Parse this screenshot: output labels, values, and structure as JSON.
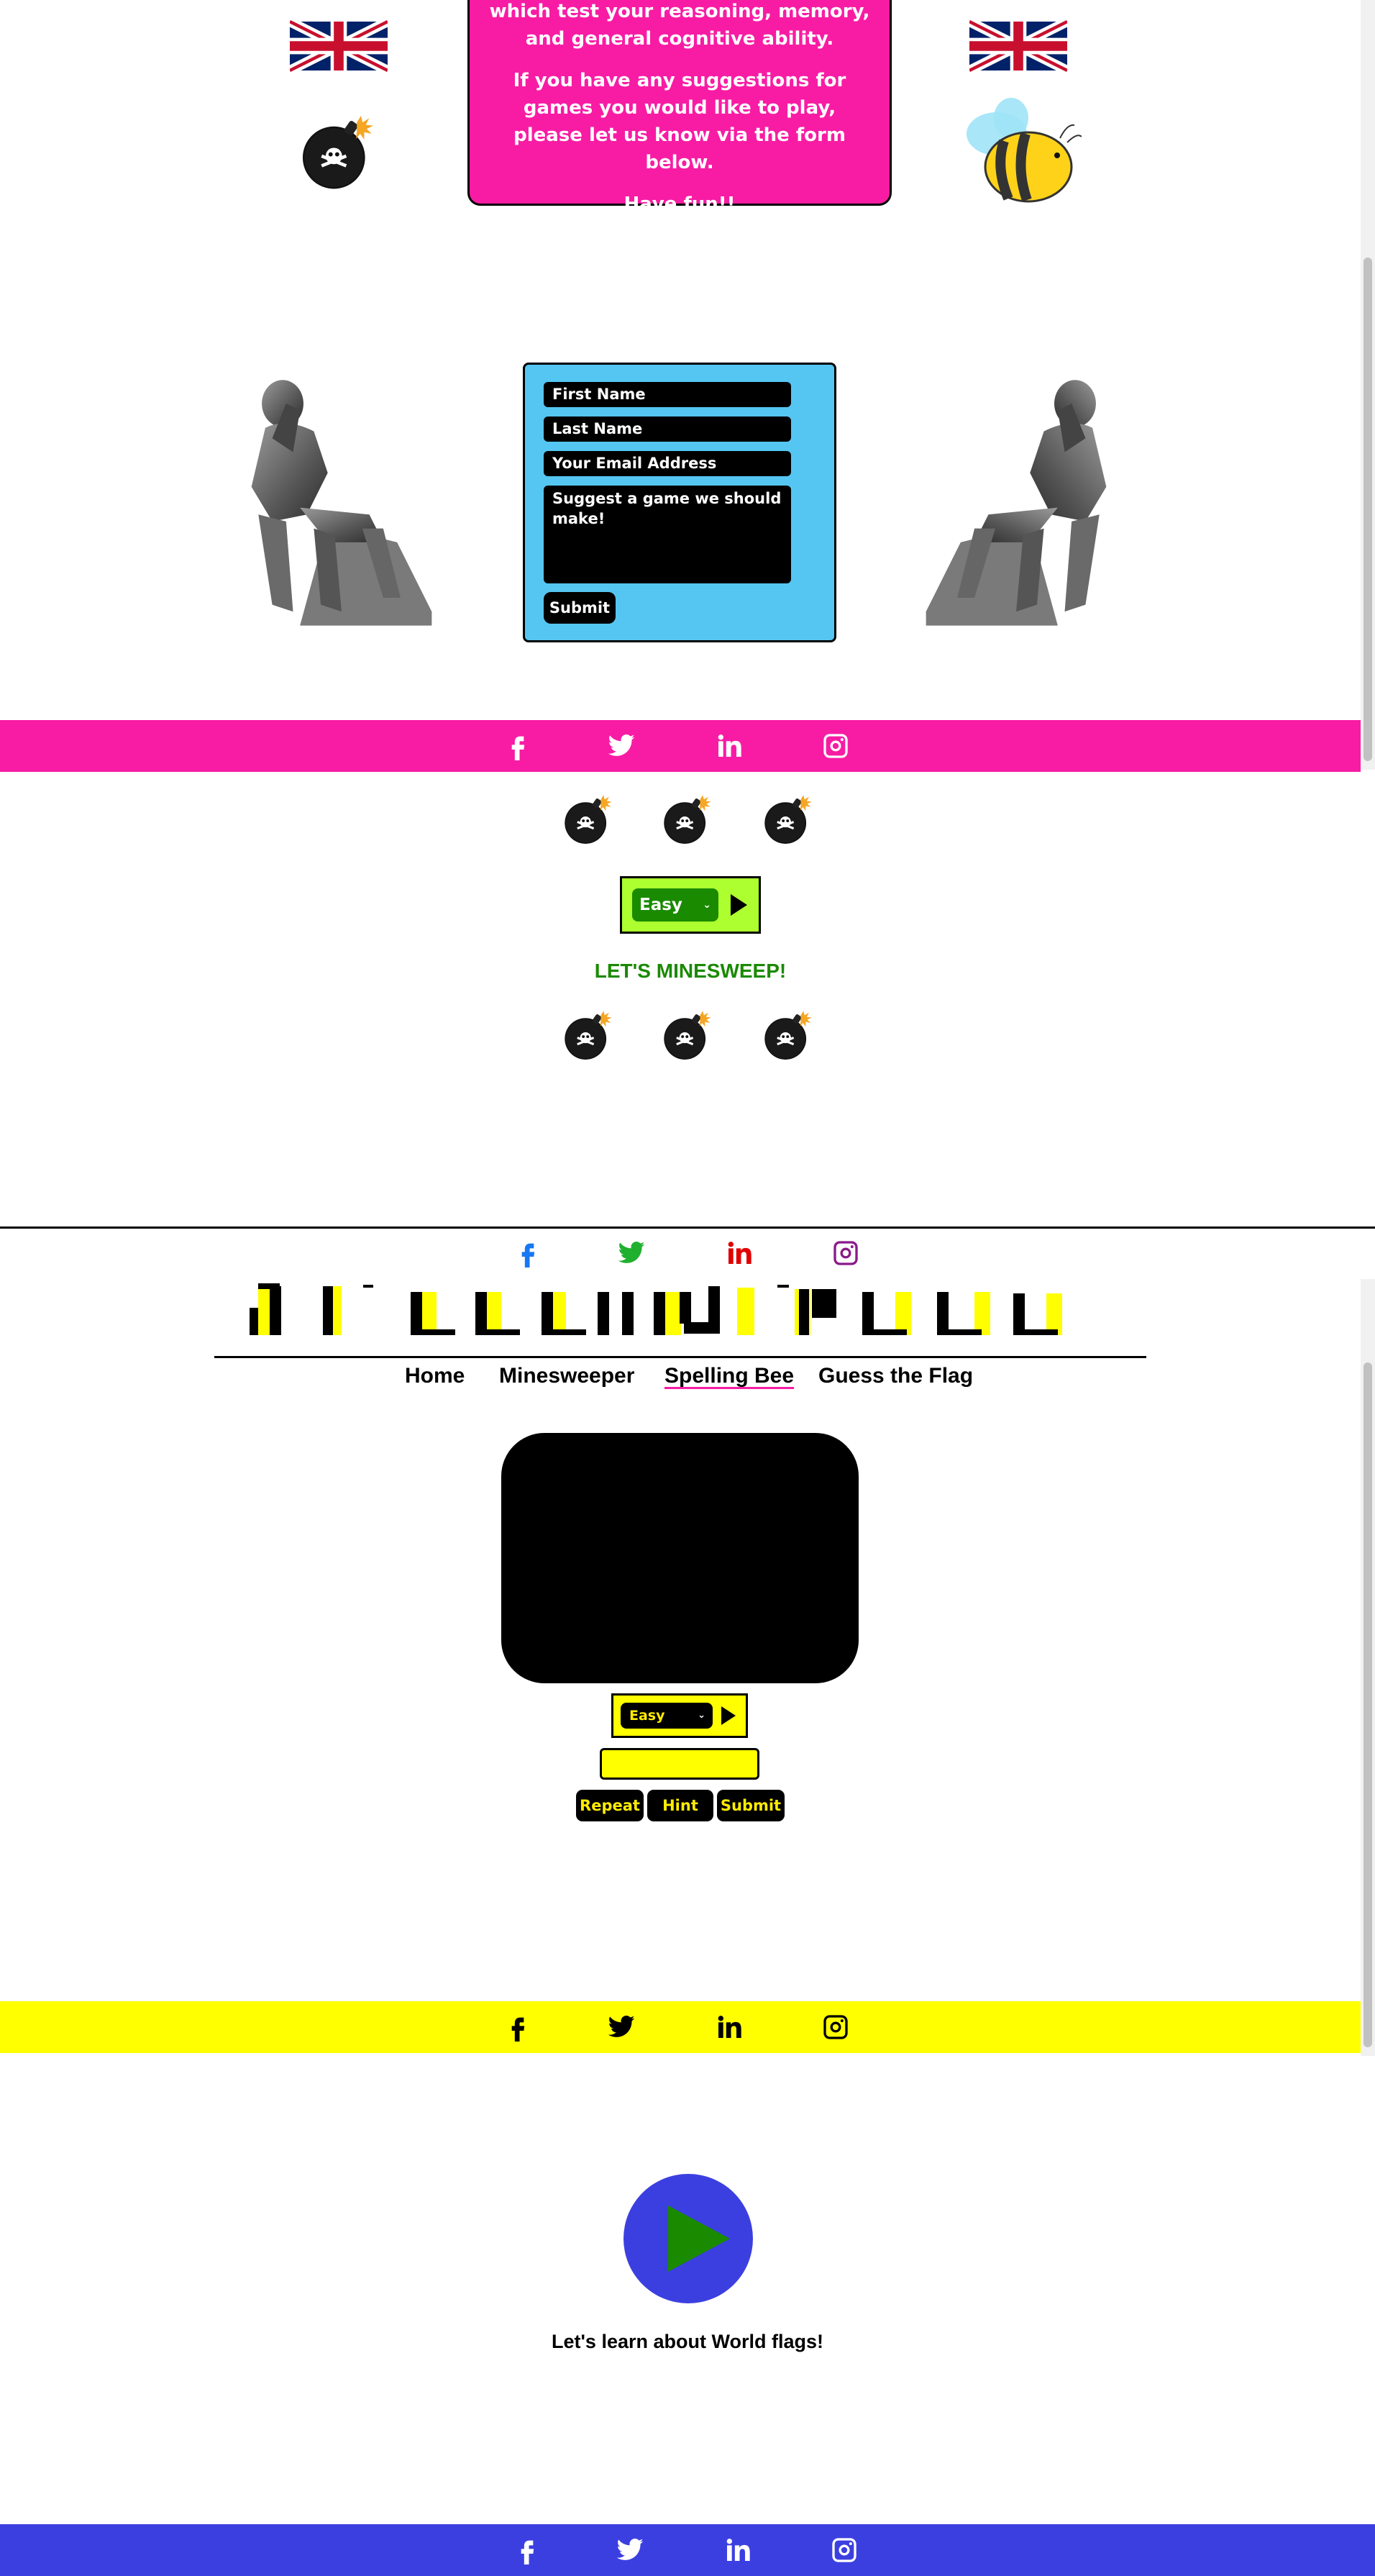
{
  "intro": {
    "line1": "which test your reasoning, memory, and general cognitive ability.",
    "line2": "If you have any suggestions for games you would like to play, please let us know via the form below.",
    "line3": "Have fun!!"
  },
  "form": {
    "first_name": "First Name",
    "last_name": "Last Name",
    "email": "Your Email Address",
    "suggestion": "Suggest a game we should make!",
    "submit": "Submit"
  },
  "colors": {
    "pink": "#f81ca4",
    "form_blue": "#55c6f2",
    "mine_green": "#adff2f",
    "dark_green": "#1a8a00",
    "bee_yellow": "#ffff00",
    "flag_blue": "#3c3fe0"
  },
  "minesweeper": {
    "difficulty": "Easy",
    "heading": "LET'S MINESWEEP!"
  },
  "nav": {
    "home": "Home",
    "minesweeper": "Minesweeper",
    "spelling_bee": "Spelling Bee",
    "guess_flag": "Guess the Flag"
  },
  "spelling_bee": {
    "difficulty": "Easy",
    "repeat": "Repeat",
    "hint": "Hint",
    "submit": "Submit"
  },
  "flags": {
    "tagline": "Let's learn about World flags!"
  },
  "icons": [
    "facebook-icon",
    "twitter-icon",
    "linkedin-icon",
    "instagram-icon",
    "bomb-icon",
    "bee-icon",
    "union-jack-icon",
    "thinker-statue-icon",
    "play-icon"
  ]
}
